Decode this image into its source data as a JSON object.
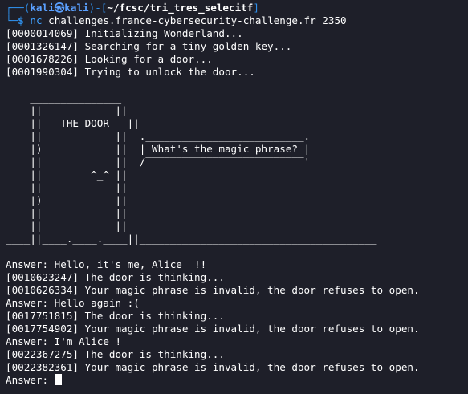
{
  "prompt": {
    "open": "┌──(",
    "user": "kali",
    "at": "㉿",
    "host": "kali",
    "mid": ")-[",
    "path": "~/fcsc/tri_tres_selecitf",
    "close": "]",
    "corner": "└─",
    "dollar": "$"
  },
  "command": {
    "name": "nc",
    "args": " challenges.france-cybersecurity-challenge.fr 2350"
  },
  "intro_lines": [
    "[0000014069] Initializing Wonderland...",
    "[0001326147] Searching for a tiny golden key...",
    "[0001678226] Looking for a door...",
    "[0001990304] Trying to unlock the door..."
  ],
  "art": {
    "door_label": "THE DOOR",
    "door_face": "^_^",
    "speech": "What's the magic phrase?"
  },
  "session_lines": [
    "Answer: Hello, it's me, Alice  !!",
    "[0010623247] The door is thinking...",
    "[0010626334] Your magic phrase is invalid, the door refuses to open.",
    "Answer: Hello again :(",
    "[0017751815] The door is thinking...",
    "[0017754902] Your magic phrase is invalid, the door refuses to open.",
    "Answer: I'm Alice !",
    "[0022367275] The door is thinking...",
    "[0022382361] Your magic phrase is invalid, the door refuses to open."
  ],
  "final_prompt": "Answer: ",
  "colors": {
    "background": "#1e1f29",
    "prompt_blue": "#2f8ee8",
    "text": "#ffffff"
  }
}
